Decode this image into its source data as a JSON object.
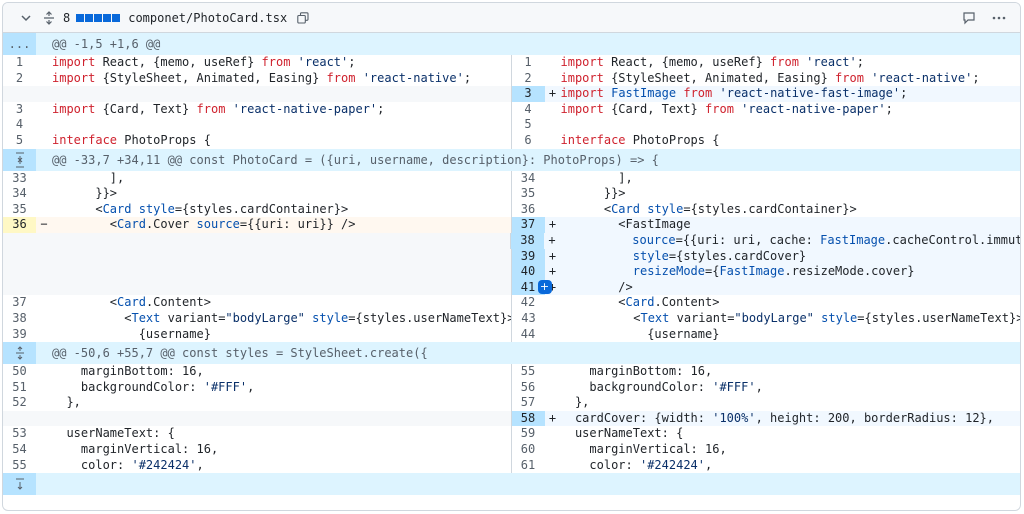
{
  "file": {
    "change_count": "8",
    "path": "componet/PhotoCard.tsx"
  },
  "hunks": [
    {
      "header": "@@ -1,5 +1,6 @@",
      "gutter": "..."
    },
    {
      "header": "@@ -33,7 +34,11 @@ const PhotoCard = ({uri, username, description}: PhotoProps) => {",
      "gutter": "expand-both"
    },
    {
      "header": "@@ -50,6 +55,7 @@ const styles = StyleSheet.create({",
      "gutter": "expand"
    },
    {
      "header": "",
      "gutter": "expand-down"
    }
  ],
  "lines": {
    "h1": [
      {
        "l": "1",
        "lc": "import React, {memo, useRef} from 'react';",
        "r": "1",
        "rc": "import React, {memo, useRef} from 'react';"
      },
      {
        "l": "2",
        "lc": "import {StyleSheet, Animated, Easing} from 'react-native';",
        "r": "2",
        "rc": "import {StyleSheet, Animated, Easing} from 'react-native';"
      },
      {
        "l": "",
        "lc": "",
        "r": "3",
        "rc": "import FastImage from 'react-native-fast-image';",
        "type": "add"
      },
      {
        "l": "3",
        "lc": "import {Card, Text} from 'react-native-paper';",
        "r": "4",
        "rc": "import {Card, Text} from 'react-native-paper';"
      },
      {
        "l": "4",
        "lc": "",
        "r": "5",
        "rc": ""
      },
      {
        "l": "5",
        "lc": "interface PhotoProps {",
        "r": "6",
        "rc": "interface PhotoProps {"
      }
    ],
    "h2": [
      {
        "l": "33",
        "lc": "        ],",
        "r": "34",
        "rc": "        ],"
      },
      {
        "l": "34",
        "lc": "      }}>",
        "r": "35",
        "rc": "      }}>"
      },
      {
        "l": "35",
        "lc": "      <Card style={styles.cardContainer}>",
        "r": "36",
        "rc": "      <Card style={styles.cardContainer}>"
      },
      {
        "l": "36",
        "lc": "        <Card.Cover source={{uri: uri}} />",
        "r": "37",
        "rc": "        <FastImage",
        "type": "change"
      },
      {
        "l": "",
        "lc": "",
        "r": "38",
        "rc": "          source={{uri: uri, cache: FastImage.cacheControl.immutable}}",
        "type": "add"
      },
      {
        "l": "",
        "lc": "",
        "r": "39",
        "rc": "          style={styles.cardCover}",
        "type": "add"
      },
      {
        "l": "",
        "lc": "",
        "r": "40",
        "rc": "          resizeMode={FastImage.resizeMode.cover}",
        "type": "add"
      },
      {
        "l": "",
        "lc": "",
        "r": "41",
        "rc": "        />",
        "type": "add",
        "plus": "+"
      },
      {
        "l": "37",
        "lc": "        <Card.Content>",
        "r": "42",
        "rc": "        <Card.Content>"
      },
      {
        "l": "38",
        "lc": "          <Text variant=\"bodyLarge\" style={styles.userNameText}>",
        "r": "43",
        "rc": "          <Text variant=\"bodyLarge\" style={styles.userNameText}>"
      },
      {
        "l": "39",
        "lc": "            {username}",
        "r": "44",
        "rc": "            {username}"
      }
    ],
    "h3": [
      {
        "l": "50",
        "lc": "    marginBottom: 16,",
        "r": "55",
        "rc": "    marginBottom: 16,"
      },
      {
        "l": "51",
        "lc": "    backgroundColor: '#FFF',",
        "r": "56",
        "rc": "    backgroundColor: '#FFF',"
      },
      {
        "l": "52",
        "lc": "  },",
        "r": "57",
        "rc": "  },"
      },
      {
        "l": "",
        "lc": "",
        "r": "58",
        "rc": "  cardCover: {width: '100%', height: 200, borderRadius: 12},",
        "type": "add"
      },
      {
        "l": "53",
        "lc": "  userNameText: {",
        "r": "59",
        "rc": "  userNameText: {"
      },
      {
        "l": "54",
        "lc": "    marginVertical: 16,",
        "r": "60",
        "rc": "    marginVertical: 16,"
      },
      {
        "l": "55",
        "lc": "    color: '#242424',",
        "r": "61",
        "rc": "    color: '#242424',"
      }
    ]
  },
  "markers": {
    "add": "+",
    "del": "−"
  }
}
